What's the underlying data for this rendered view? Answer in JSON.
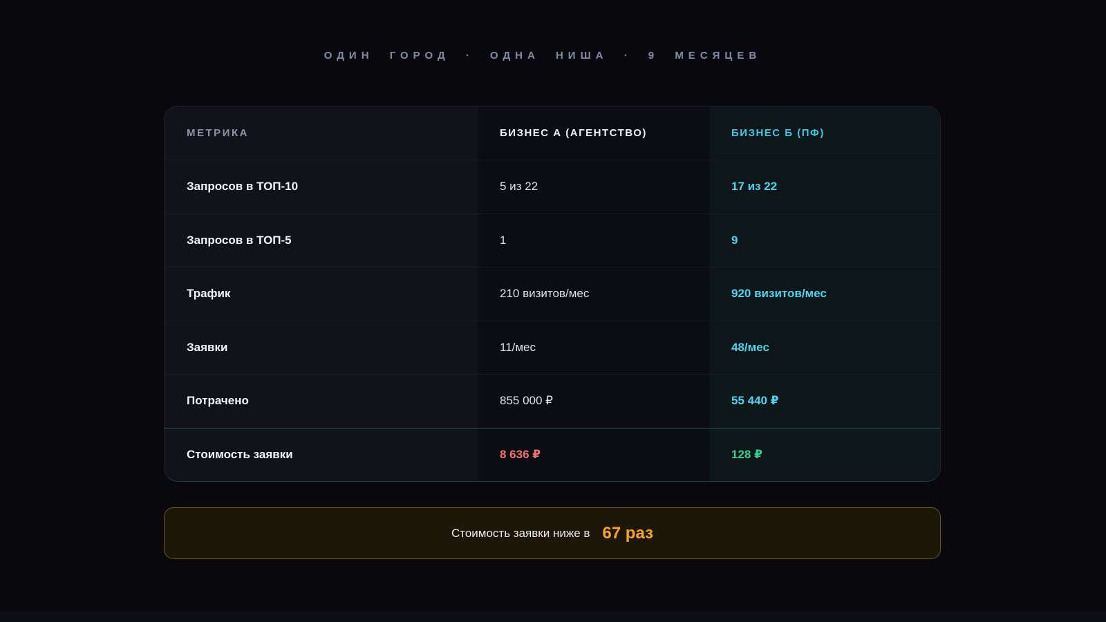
{
  "header": {
    "tagline": "ОДИН ГОРОД · ОДНА НИША · 9 МЕСЯЦЕВ"
  },
  "table": {
    "columns": [
      "МЕТРИКА",
      "БИЗНЕС А (АГЕНТСТВО)",
      "БИЗНЕС Б (ПФ)"
    ],
    "rows": [
      {
        "metric": "Запросов в ТОП-10",
        "a": "5 из 22",
        "b": "17 из 22"
      },
      {
        "metric": "Запросов в ТОП-5",
        "a": "1",
        "b": "9"
      },
      {
        "metric": "Трафик",
        "a": "210 визитов/мес",
        "b": "920 визитов/мес"
      },
      {
        "metric": "Заявки",
        "a": "11/мес",
        "b": "48/мес"
      },
      {
        "metric": "Потрачено",
        "a": "855 000 ₽",
        "b": "55 440 ₽"
      },
      {
        "metric": "Стоимость заявки",
        "a": "8 636 ₽",
        "b": "128 ₽",
        "highlight": true,
        "a_color": "red",
        "b_color": "green"
      }
    ]
  },
  "banner": {
    "text": "Стоимость заявки ниже в",
    "value": "67 раз"
  },
  "colors": {
    "accent_cyan": "#4dd4ee",
    "loss_red": "#f17171",
    "win_green": "#30d191",
    "highlight_orange": "#f5a621",
    "background": "#08080d"
  }
}
